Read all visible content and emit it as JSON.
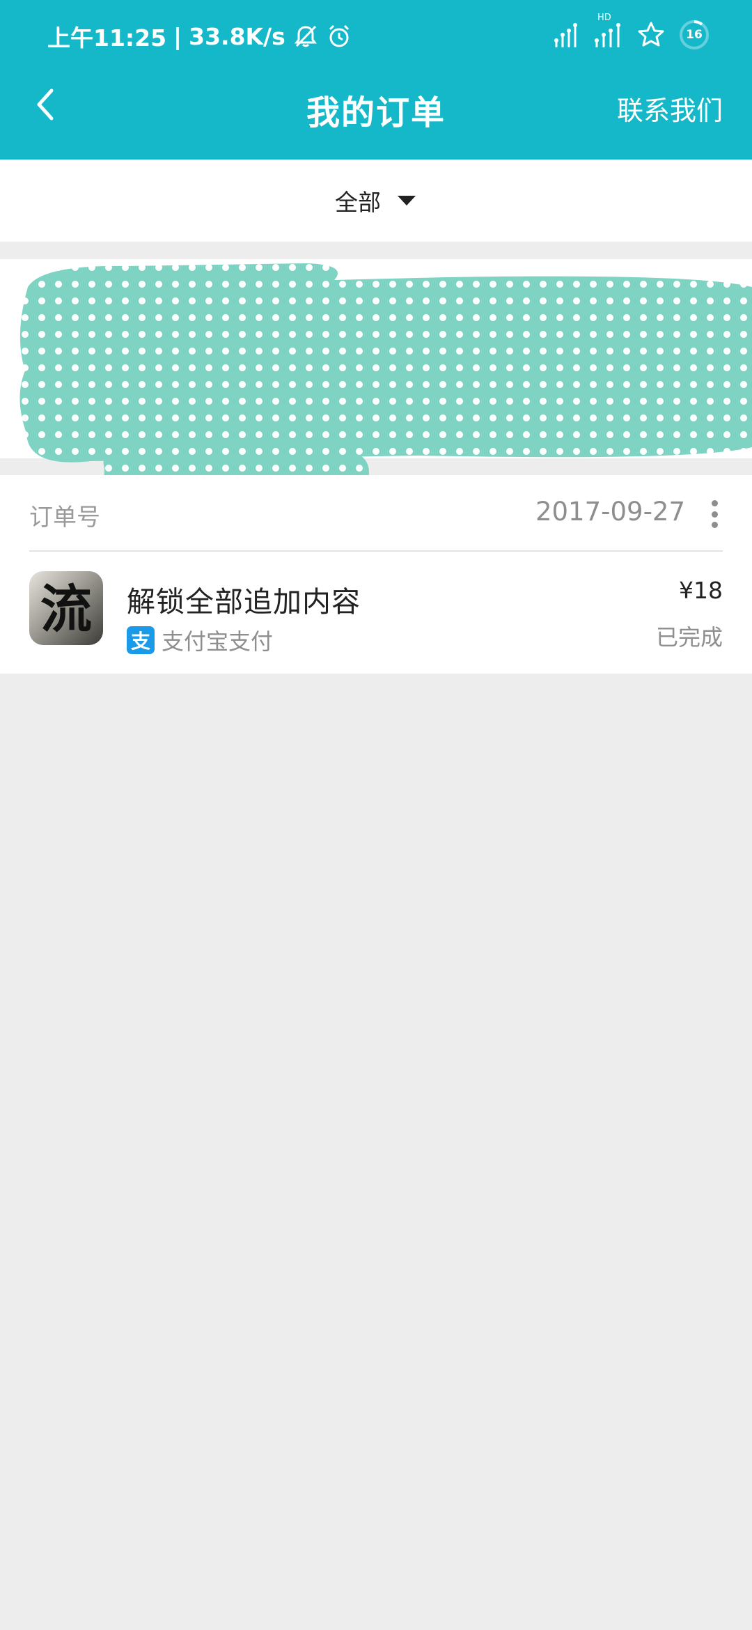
{
  "status_bar": {
    "time": "上午11:25",
    "separator": "|",
    "network_speed": "33.8K/s",
    "network_badge": "HD",
    "battery_level": "16",
    "icons": [
      "bell-mute-icon",
      "alarm-icon",
      "signal-icon",
      "signal-icon",
      "star-icon",
      "battery-icon"
    ]
  },
  "header": {
    "title": "我的订单",
    "contact_label": "联系我们",
    "accent_color": "#15b8c9"
  },
  "filter": {
    "selected": "全部"
  },
  "orders": [
    {
      "order_no_label": "订单号",
      "date": "2017-09-27",
      "item_title": "解锁全部追加内容",
      "app_icon_char": "流",
      "payment_method": "支付宝支付",
      "payment_icon_char": "支",
      "price": "¥18",
      "status": "已完成"
    }
  ]
}
